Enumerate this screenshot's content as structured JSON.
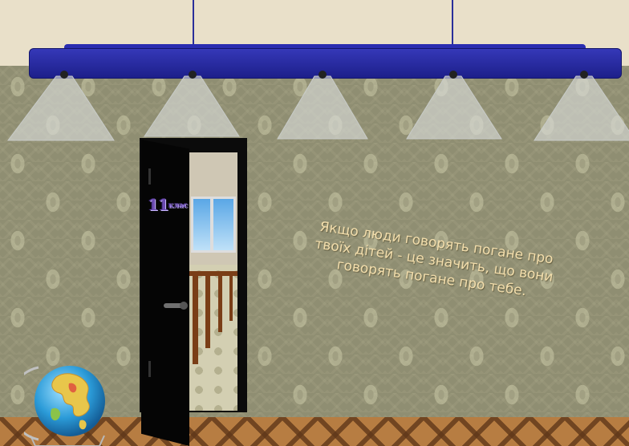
{
  "scene": {
    "door_sign": {
      "number": "11",
      "suffix": "клас"
    },
    "quote_lines": [
      "Якщо люди говорять погане про",
      "твоїх дітей - це значить, що вони",
      "говорять погане про тебе."
    ],
    "colors": {
      "wall": "#8f8e72",
      "ceiling": "#e9e0c9",
      "lamp_bar": "#2a2db0",
      "quote_text": "#f3deac",
      "door": "#0b0b0b",
      "floor": "#b77d42"
    }
  }
}
